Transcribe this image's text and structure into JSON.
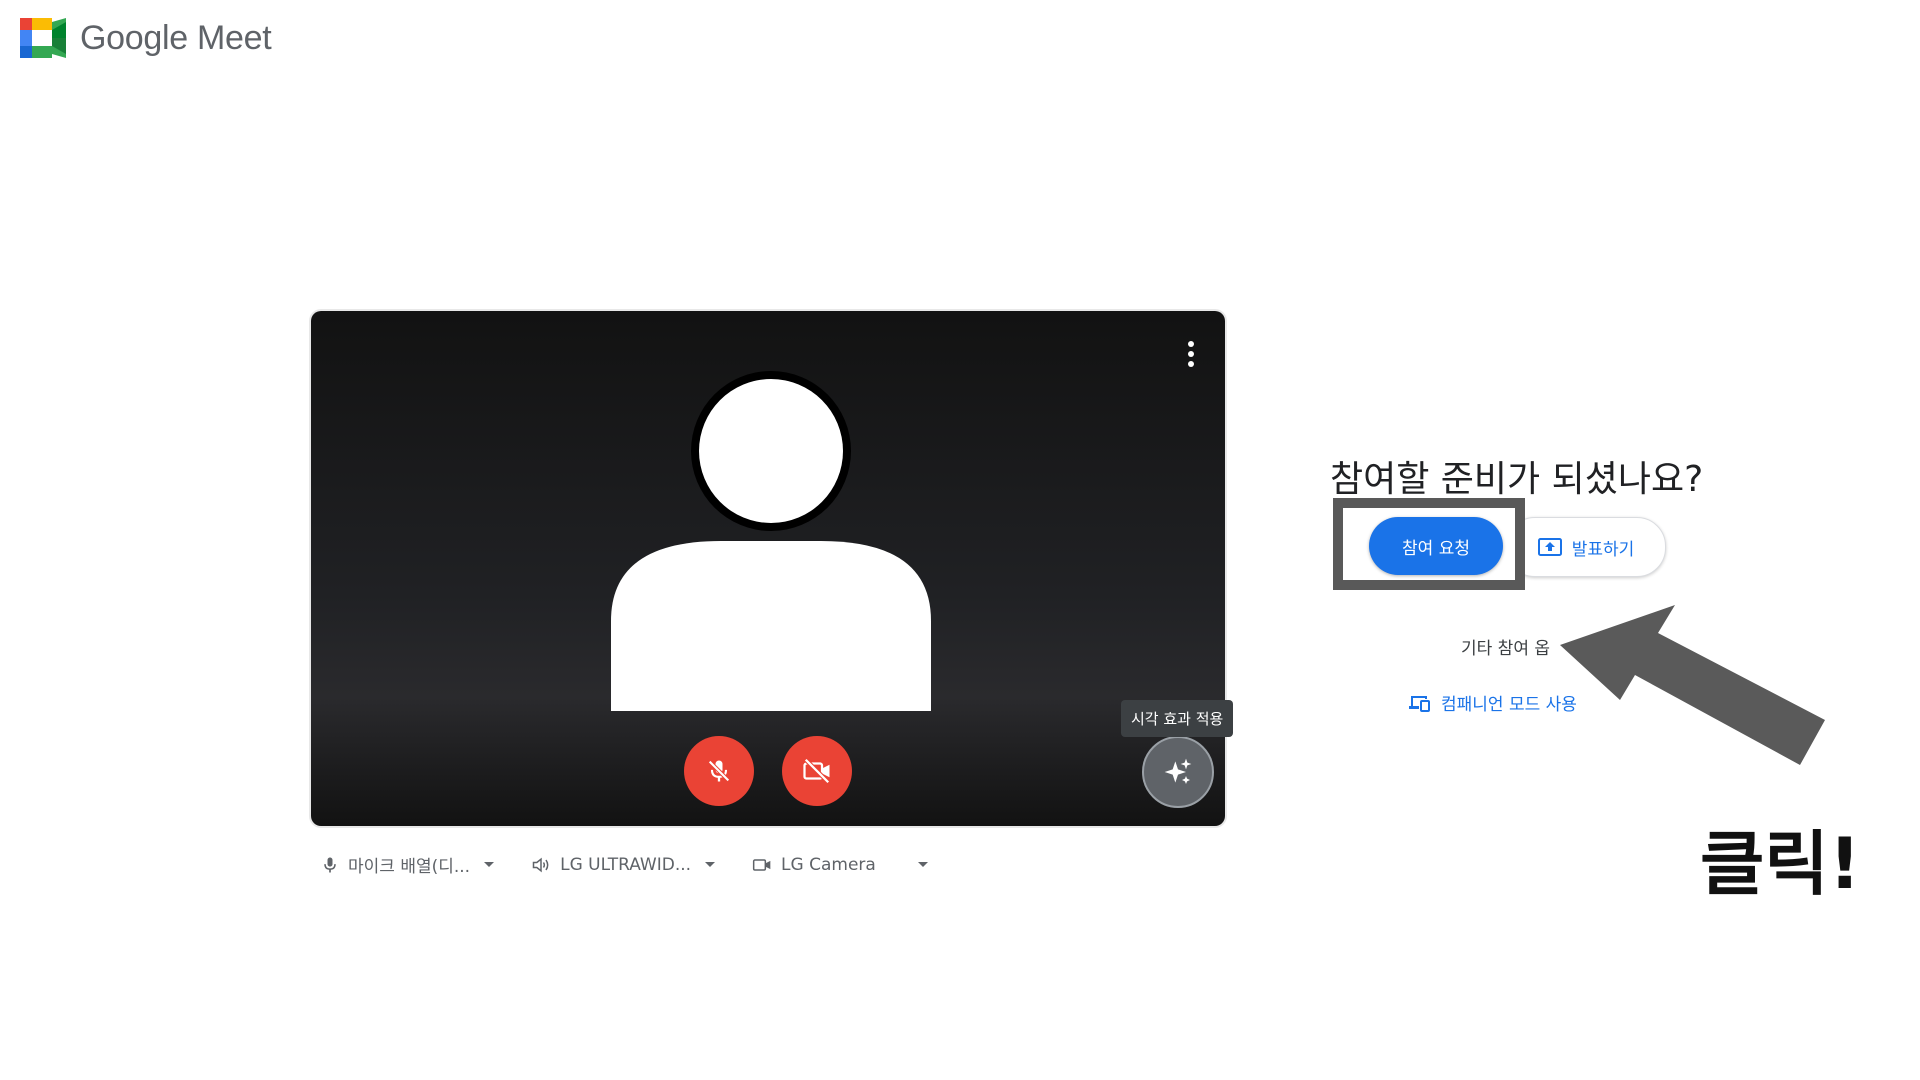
{
  "app": {
    "brand_name": "Google Meet"
  },
  "preview": {
    "tooltip": "시각 효과 적용"
  },
  "devices": {
    "microphone": "마이크 배열(디...",
    "speaker": "LG ULTRAWID...",
    "camera": "LG Camera"
  },
  "join_panel": {
    "title": "참여할 준비가 되셨나요?",
    "join_button": "참여 요청",
    "present_button": "발표하기",
    "other_options": "기타 참여 옵",
    "companion_mode": "컴패니언 모드 사용"
  },
  "annotation": {
    "click_label": "클릭!"
  },
  "colors": {
    "accent": "#1a73e8",
    "danger": "#ea4335",
    "highlight_box": "#595959"
  }
}
